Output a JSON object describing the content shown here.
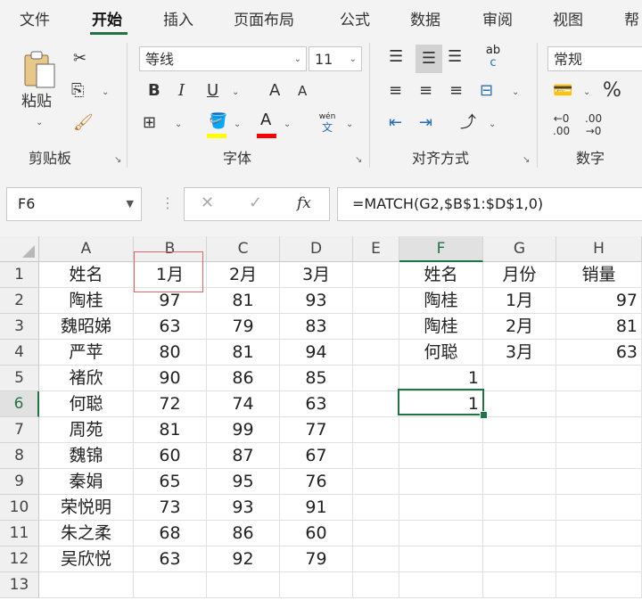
{
  "tabs": [
    "文件",
    "开始",
    "插入",
    "页面布局",
    "公式",
    "数据",
    "审阅",
    "视图",
    "帮"
  ],
  "active_tab": "开始",
  "ribbon": {
    "clipboard": {
      "paste_label": "粘贴",
      "group_label": "剪贴板"
    },
    "font": {
      "font_name": "等线",
      "font_size": "11",
      "bold": "B",
      "italic": "I",
      "underline": "U",
      "grow": "A",
      "shrink": "A",
      "font_color_glyph": "A",
      "phonetic_top": "wén",
      "phonetic_bottom": "文",
      "group_label": "字体"
    },
    "alignment": {
      "group_label": "对齐方式",
      "wrap_top": "ab",
      "wrap_bottom": "c"
    },
    "number": {
      "format": "常规",
      "percent": "%",
      "group_label": "数字"
    },
    "colors": {
      "accent": "#217346",
      "highlight": "#ffff00",
      "font_color": "#ff0000"
    }
  },
  "formula_bar": {
    "name_box": "F6",
    "formula": "=MATCH(G2,$B$1:$D$1,0)",
    "cancel": "✕",
    "enter": "✓",
    "fx": "fx"
  },
  "sheet": {
    "columns": [
      "A",
      "B",
      "C",
      "D",
      "E",
      "F",
      "G",
      "H"
    ],
    "rows": [
      "1",
      "2",
      "3",
      "4",
      "5",
      "6",
      "7",
      "8",
      "9",
      "10",
      "11",
      "12",
      "13"
    ],
    "selected_column": "F",
    "selected_row": "6",
    "table_header": [
      "姓名",
      "1月",
      "2月",
      "3月"
    ],
    "table_rows": [
      [
        "陶桂",
        "97",
        "81",
        "93"
      ],
      [
        "魏昭娣",
        "63",
        "79",
        "83"
      ],
      [
        "严苹",
        "80",
        "81",
        "94"
      ],
      [
        "褚欣",
        "90",
        "86",
        "85"
      ],
      [
        "何聪",
        "72",
        "74",
        "63"
      ],
      [
        "周苑",
        "81",
        "99",
        "77"
      ],
      [
        "魏锦",
        "60",
        "87",
        "67"
      ],
      [
        "秦娟",
        "65",
        "95",
        "76"
      ],
      [
        "荣悦明",
        "73",
        "93",
        "91"
      ],
      [
        "朱之柔",
        "68",
        "86",
        "60"
      ],
      [
        "吴欣悦",
        "63",
        "92",
        "79"
      ]
    ],
    "lookup_header": [
      "姓名",
      "月份",
      "销量"
    ],
    "lookup_rows": [
      [
        "陶桂",
        "1月",
        "97"
      ],
      [
        "陶桂",
        "2月",
        "81"
      ],
      [
        "何聪",
        "3月",
        "63"
      ]
    ],
    "f5": "1",
    "f6": "1"
  }
}
